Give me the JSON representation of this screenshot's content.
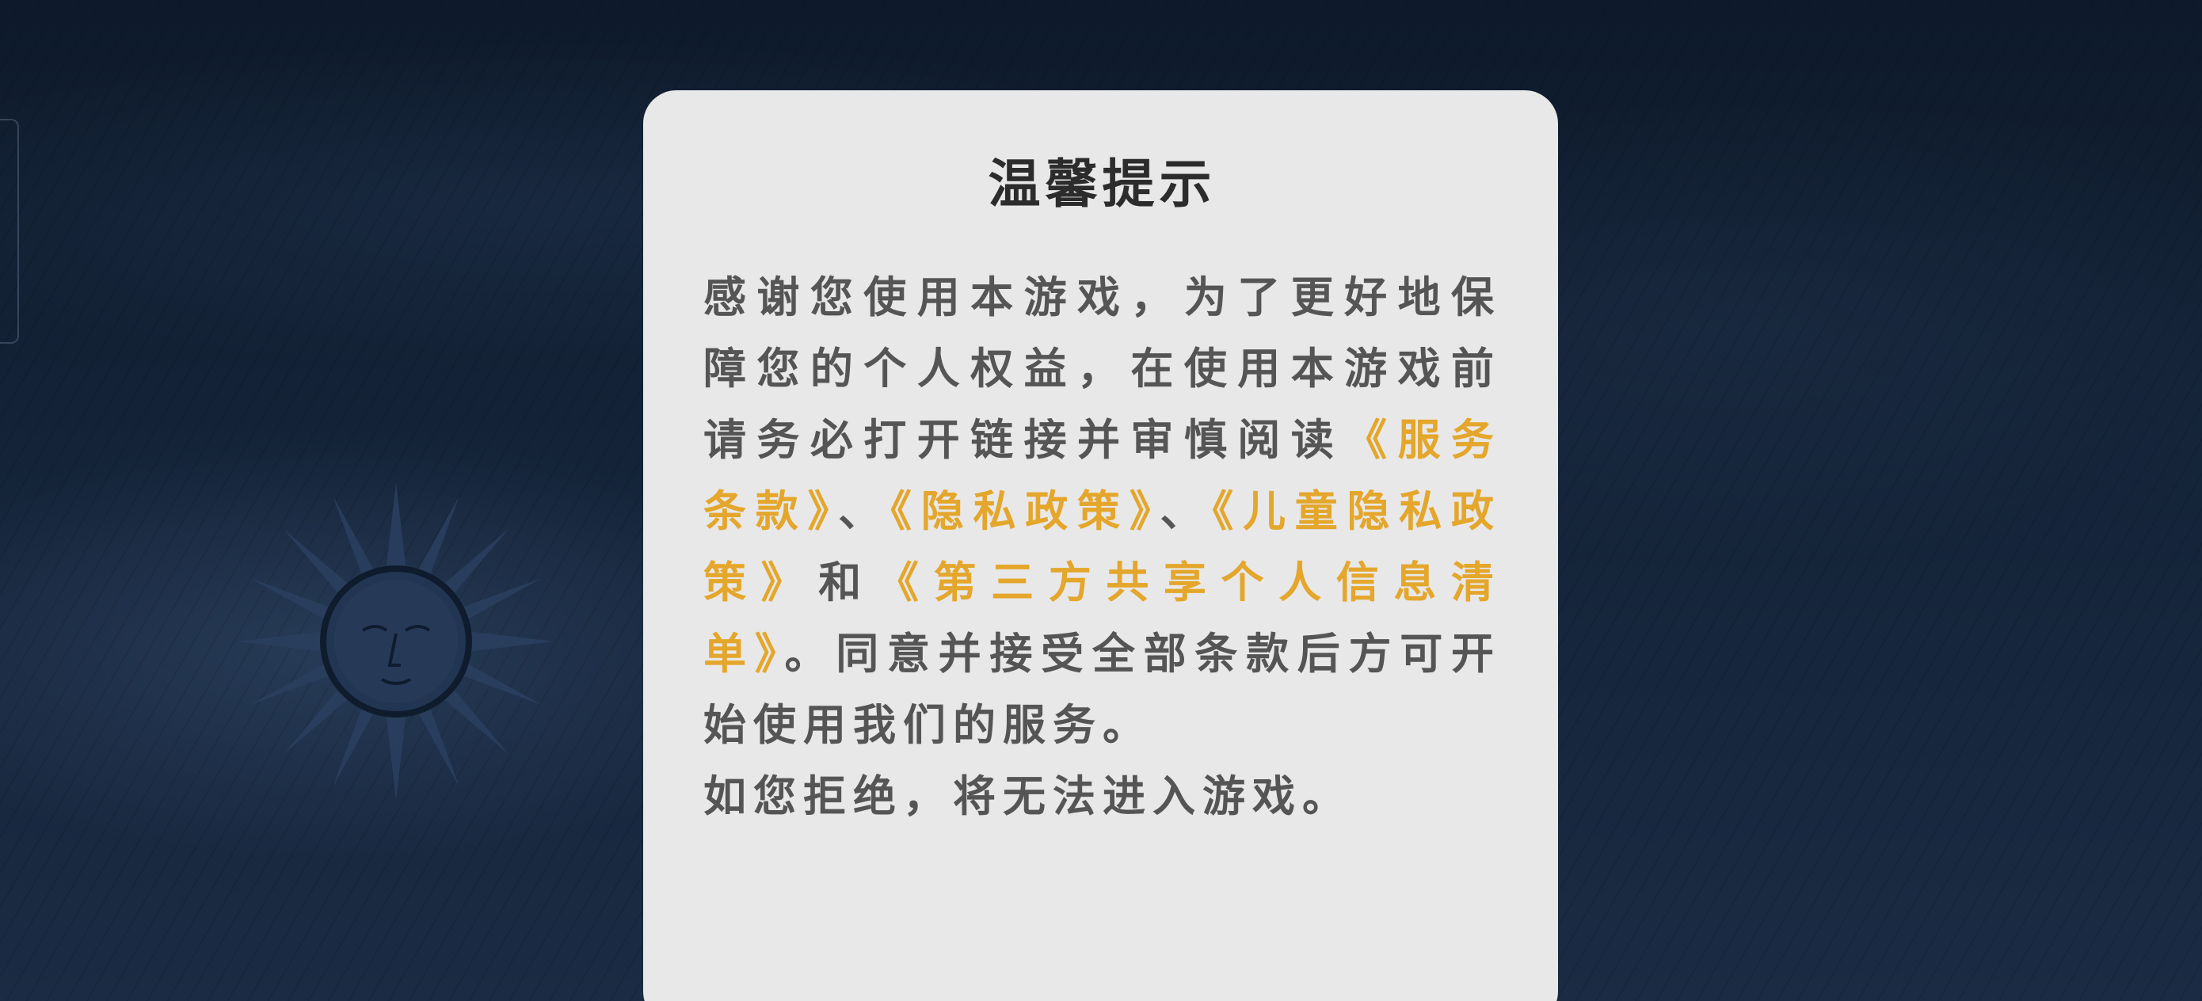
{
  "dialog": {
    "title": "温馨提示",
    "intro": "感谢您使用本游戏，为了更好地保障您的个人权益，在使用本游戏前请务必打开链接并审慎阅读",
    "link_terms": "《服务条款》",
    "sep1": "、",
    "link_privacy": "《隐私政策》",
    "sep2": "、",
    "link_child_privacy": "《儿童隐私政策》",
    "sep3": "和",
    "link_third_party": "《第三方共享个人信息清单》",
    "outro": "。同意并接受全部条款后方可开始使用我们的服务。",
    "refuse_note": "如您拒绝，将无法进入游戏。"
  },
  "colors": {
    "link": "#e4a62b",
    "text": "#555555",
    "title": "#2c2c2c",
    "dialog_bg": "#e8e8e8",
    "background": "#0f1c2e"
  },
  "icons": {
    "sun": "sun-face-emblem"
  }
}
